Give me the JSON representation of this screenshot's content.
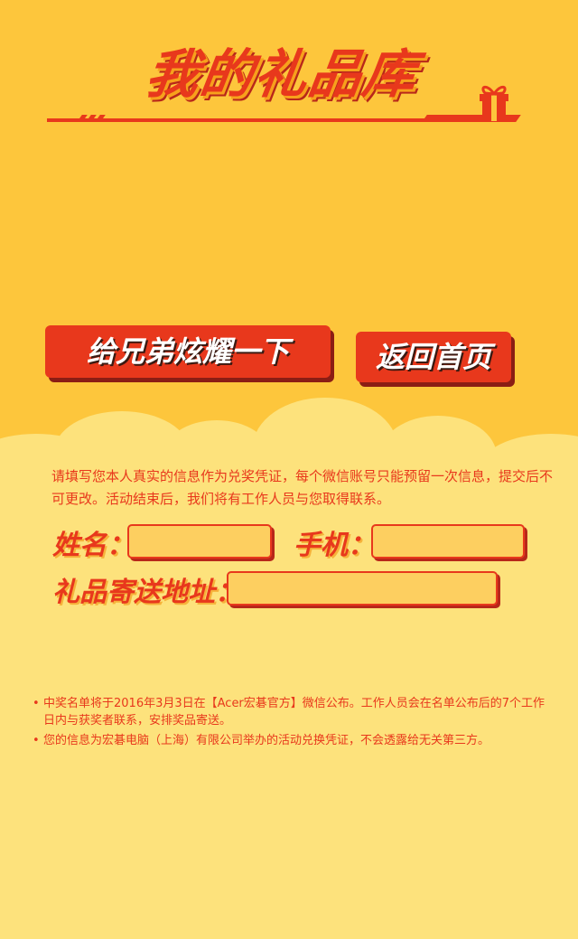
{
  "page": {
    "title": "我的礼品库",
    "colors": {
      "background": "#fdc63c",
      "lower_background": "#fde27c",
      "accent": "#e8381c",
      "field_fill": "#fdcf60"
    }
  },
  "actions": {
    "share_label": "给兄弟炫耀一下",
    "home_label": "返回首页"
  },
  "form": {
    "notice": "请填写您本人真实的信息作为兑奖凭证，每个微信账号只能预留一次信息，提交后不可更改。活动结束后，我们将有工作人员与您取得联系。",
    "name_label": "姓名：",
    "name_value": "",
    "phone_label": "手机：",
    "phone_value": "",
    "address_label": "礼品寄送地址：",
    "address_value": ""
  },
  "rules": {
    "bullet": "•",
    "items": [
      "中奖名单将于2016年3月3日在【Acer宏碁官方】微信公布。工作人员会在名单公布后的7个工作日内与获奖者联系，安排奖品寄送。",
      "您的信息为宏碁电脑（上海）有限公司举办的活动兑换凭证，不会透露给无关第三方。"
    ]
  },
  "icons": {
    "gift": "gift-icon"
  }
}
